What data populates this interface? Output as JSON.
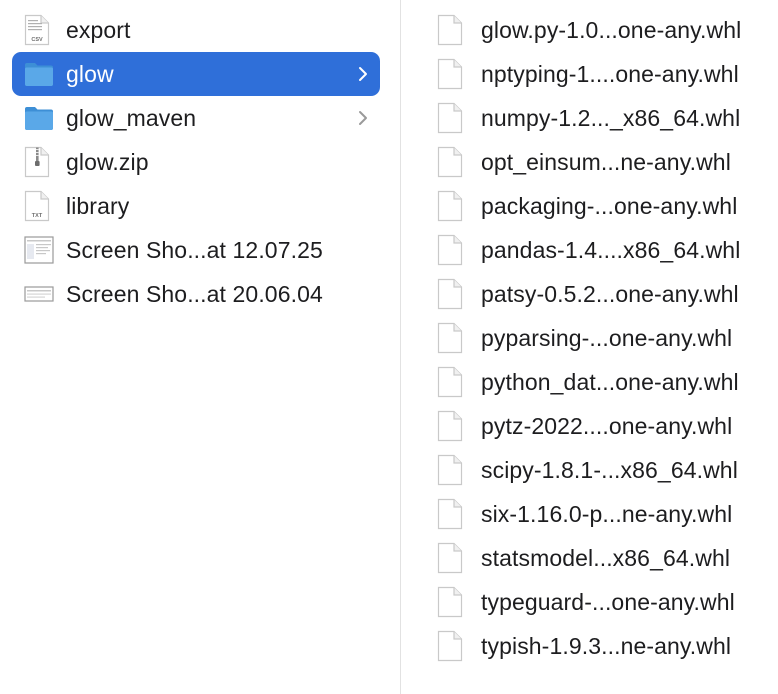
{
  "left_column": {
    "items": [
      {
        "label": "export",
        "icon": "csv-file-icon",
        "kind": "csv-file",
        "selected": false,
        "has_children": false
      },
      {
        "label": "glow",
        "icon": "folder-icon",
        "kind": "folder",
        "selected": true,
        "has_children": true
      },
      {
        "label": "glow_maven",
        "icon": "folder-icon",
        "kind": "folder",
        "selected": false,
        "has_children": true
      },
      {
        "label": "glow.zip",
        "icon": "zip-file-icon",
        "kind": "zip-file",
        "selected": false,
        "has_children": false
      },
      {
        "label": "library",
        "icon": "txt-file-icon",
        "kind": "txt-file",
        "selected": false,
        "has_children": false
      },
      {
        "label": "Screen Sho...at 12.07.25",
        "icon": "screenshot-thumbnail-icon",
        "kind": "screenshot",
        "selected": false,
        "has_children": false
      },
      {
        "label": "Screen Sho...at 20.06.04",
        "icon": "screenshot-thumbnail-icon",
        "kind": "screenshot-wide",
        "selected": false,
        "has_children": false
      }
    ]
  },
  "right_column": {
    "items": [
      {
        "label": "glow.py-1.0...one-any.whl",
        "icon": "document-icon"
      },
      {
        "label": "nptyping-1....one-any.whl",
        "icon": "document-icon"
      },
      {
        "label": "numpy-1.2..._x86_64.whl",
        "icon": "document-icon"
      },
      {
        "label": "opt_einsum...ne-any.whl",
        "icon": "document-icon"
      },
      {
        "label": "packaging-...one-any.whl",
        "icon": "document-icon"
      },
      {
        "label": "pandas-1.4....x86_64.whl",
        "icon": "document-icon"
      },
      {
        "label": "patsy-0.5.2...one-any.whl",
        "icon": "document-icon"
      },
      {
        "label": "pyparsing-...one-any.whl",
        "icon": "document-icon"
      },
      {
        "label": "python_dat...one-any.whl",
        "icon": "document-icon"
      },
      {
        "label": "pytz-2022....one-any.whl",
        "icon": "document-icon"
      },
      {
        "label": "scipy-1.8.1-...x86_64.whl",
        "icon": "document-icon"
      },
      {
        "label": "six-1.16.0-p...ne-any.whl",
        "icon": "document-icon"
      },
      {
        "label": "statsmodel...x86_64.whl",
        "icon": "document-icon"
      },
      {
        "label": "typeguard-...one-any.whl",
        "icon": "document-icon"
      },
      {
        "label": "typish-1.9.3...ne-any.whl",
        "icon": "document-icon"
      }
    ]
  },
  "icon_badges": {
    "csv": "CSV",
    "txt": "TXT"
  },
  "colors": {
    "selection": "#2f6fd9",
    "folder": "#5aa8e8",
    "folder_dark": "#3d8fd6",
    "divider": "#e2e2e2"
  }
}
